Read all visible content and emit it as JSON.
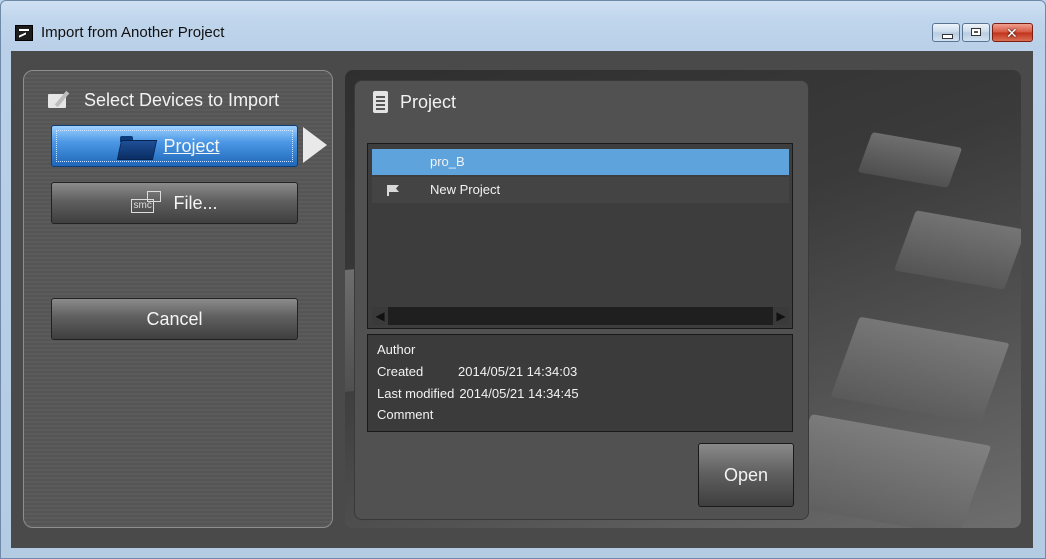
{
  "window": {
    "title": "Import from Another Project"
  },
  "left": {
    "header": "Select Devices to Import",
    "buttons": {
      "project": "Project",
      "file": "File...",
      "cancel": "Cancel"
    }
  },
  "project_panel": {
    "header": "Project",
    "items": [
      {
        "label": "pro_B",
        "selected": true
      },
      {
        "label": "New Project",
        "selected": false,
        "icon": "flag-icon"
      }
    ]
  },
  "details": {
    "author_label": "Author",
    "author_value": "",
    "created_label": "Created",
    "created_value": "2014/05/21 14:34:03",
    "modified_label": "Last modified",
    "modified_value": "2014/05/21 14:34:45",
    "comment_label": "Comment",
    "comment_value": ""
  },
  "open_label": "Open",
  "colors": {
    "selection": "#5ea3dc",
    "project_button": "#4c98e6",
    "panel": "#515151"
  }
}
